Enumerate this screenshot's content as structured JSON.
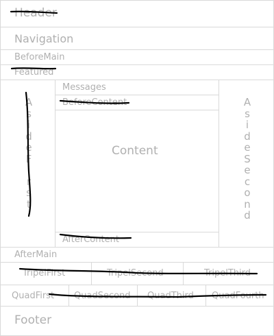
{
  "regions": {
    "header": "Header",
    "navigation": "Navigation",
    "before_main": "BeforeMain",
    "featured": "Featured",
    "aside_first": "AsideFirst",
    "messages": "Messages",
    "before_content": "BeforeContent",
    "content": "Content",
    "after_content": "AfterContent",
    "aside_second": "AsideSecond",
    "after_main": "AfterMain",
    "tripel_first": "TripelFirst",
    "tripel_second": "TripelSecond",
    "tripel_third": "TripelThird",
    "quad_first": "QuadFirst",
    "quad_second": "QuadSecond",
    "quad_third": "QuadThird",
    "quad_fourth": "QuadFourth",
    "footer": "Footer"
  },
  "colors": {
    "border": "#d9d9d9",
    "label": "#b0b0b0",
    "ink": "#000000"
  }
}
